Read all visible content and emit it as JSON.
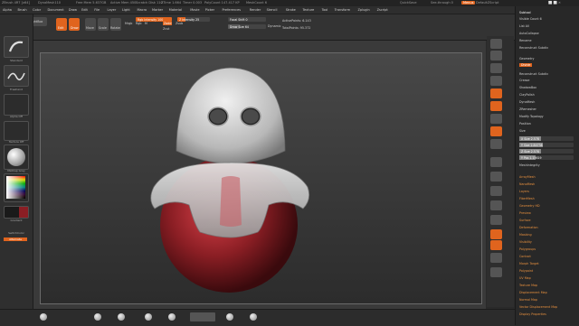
{
  "title_bar": {
    "app": "ZBrush 4R7 [x64]",
    "doc": "DynaMesh110",
    "free_mem": "Free Mem 5.637GB",
    "active_mem": "Active Mem 450",
    "scratch": "Scratch Disk 110",
    "ztime": "ZTime 1.664",
    "timer": "Timer 0.003",
    "polycount": "PolyCount 147.417 KP",
    "meshcount": "MeshCount 6",
    "quicksave": "QuickSave",
    "seethrough": "See-through 0",
    "menus_btn": "Menus",
    "defaultscript": "DefaultZScript"
  },
  "menus": [
    "Alpha",
    "Brush",
    "Color",
    "Document",
    "Draw",
    "Edit",
    "File",
    "Layer",
    "Light",
    "Macro",
    "Marker",
    "Material",
    "Movie",
    "Picker",
    "Preferences",
    "Render",
    "Stencil",
    "Stroke",
    "Texture",
    "Tool",
    "Transform",
    "Zplugin",
    "Zscript"
  ],
  "toolbar": {
    "projection_master": "Projection Master",
    "lightbox": "LightBox",
    "quick_sketch": "Quick Sketch",
    "edit": "Edit",
    "draw": "Draw",
    "move": "Move",
    "scale": "Scale",
    "rotate": "Rotate",
    "mrgb": "Mrgb",
    "rgb": "Rgb",
    "m": "M",
    "zadd": "Zadd",
    "zsub": "Zsub",
    "zcut": "Zcut",
    "rgb_intensity": "Rgb Intensity 100",
    "z_intensity": "Z Intensity 25",
    "focal_shift": "Focal Shift 0",
    "draw_size": "Draw Size 64",
    "dynamic": "Dynamic",
    "active_points": "ActivePoints: 6.143",
    "total_points": "TotalPoints: 95.372",
    "rgb_intensity_level": 1.0,
    "z_intensity_level": 0.25
  },
  "left_shelf": {
    "brush_label": "Standard",
    "stroke_label": "Freehand",
    "alpha_label": "Alpha Off",
    "texture_label": "Texture Off",
    "material_label": "MatCap Gray",
    "gradient_label": "Gradient",
    "switch_color": "SwitchColor",
    "alternate": "Alternate"
  },
  "right_shelf": {
    "bpr": "BPR",
    "spix": "SPix 3",
    "scroll": "Scroll",
    "zoom": "Zoom",
    "actual": "Actual",
    "aahalf": "AAHalf",
    "persp": "Persp",
    "floor": "Floor",
    "local": "Local",
    "lsym": "L.Sym",
    "xyz": "Xyz",
    "frame": "Frame",
    "move": "Move",
    "scale": "Scale",
    "rotate": "Rotate",
    "polyf": "PolyF",
    "transp": "Transp",
    "ghost": "Ghost",
    "solo": "Solo",
    "xpose": "Xpose"
  },
  "tray": {
    "subtool": "Subtool",
    "visible_count": "Visible Count 6",
    "list_all": "List All",
    "autocollapse": "AutoCollapse",
    "rename": "Rename",
    "reconstruct": "Reconstruct Subdiv",
    "geometry": "Geometry",
    "lower_res": "Lower Res",
    "higher_res": "Higher Res",
    "sdiv": "SDiv",
    "del_lower": "Del Lower",
    "del_higher": "Del Higher",
    "divide": "Divide",
    "reconstruct_sub": "Reconstruct Subdiv",
    "convert_bpr": "Convert BPR To Geo",
    "crease": "Crease",
    "shadowbox": "ShadowBox",
    "claypolish": "ClayPolish",
    "dynamesh": "DynaMesh",
    "zremesher": "ZRemesher",
    "modify_topology": "Modify Topology",
    "position": "Position",
    "size": "Size",
    "mesh_integrity": "MeshIntegrity",
    "x_size": "X Size 2.578",
    "y_size": "Y Size 2.84738",
    "z_size": "Z Size 2.578",
    "mid": "Mid",
    "unify": "Unify",
    "x_pos": "X Pos 0",
    "y_pos": "Y Pos 1.15619",
    "arraymesh": "ArrayMesh",
    "nanomesh": "NanoMesh",
    "layers": "Layers",
    "fibermesh": "FiberMesh",
    "geometry_hd": "Geometry HD",
    "preview": "Preview",
    "surface": "Surface",
    "deformation": "Deformation",
    "masking": "Masking",
    "visibility": "Visibility",
    "polygroups": "Polygroups",
    "contact": "Contact",
    "morph_target": "Morph Target",
    "polypaint": "Polypaint",
    "uv_map": "UV Map",
    "texture_map": "Texture Map",
    "displacement_map": "Displacement Map",
    "normal_map": "Normal Map",
    "vector_displacement_map": "Vector Displacement Map",
    "display_properties": "Display Properties"
  },
  "colors": {
    "accent": "#e0641e",
    "robot_red": "#8a1e24",
    "shell_gray": "#d8d8d8"
  }
}
